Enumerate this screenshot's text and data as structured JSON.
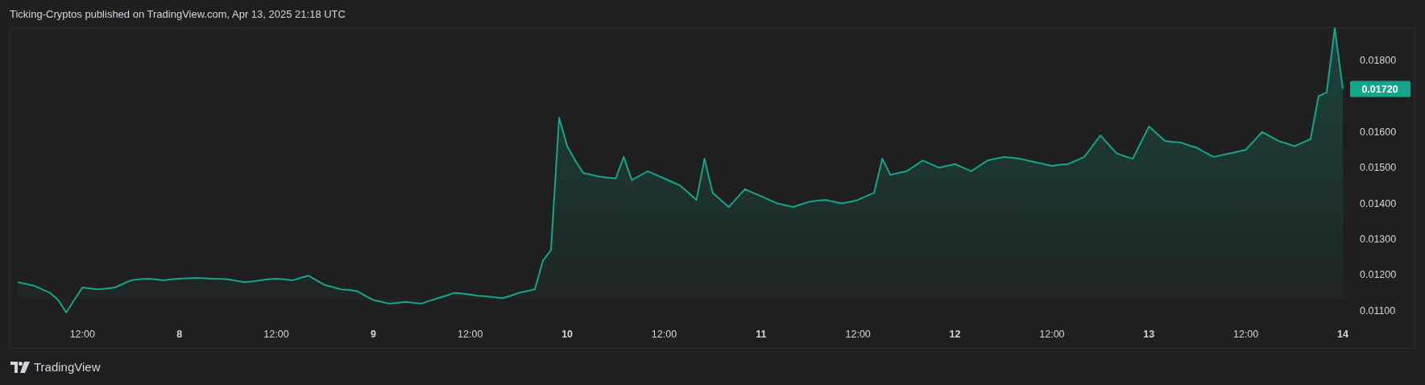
{
  "header": {
    "text": "Ticking-Cryptos published on TradingView.com, Apr 13, 2025 21:18 UTC"
  },
  "chart": {
    "chart_data": {
      "type": "area",
      "categories": [
        null,
        null,
        null,
        null,
        null,
        null,
        null,
        null,
        "12:00",
        null,
        null,
        null,
        null,
        null,
        null,
        null,
        null,
        null,
        null,
        null,
        "8",
        null,
        null,
        null,
        null,
        null,
        null,
        null,
        null,
        null,
        null,
        null,
        "12:00",
        null,
        null,
        null,
        null,
        null,
        null,
        null,
        null,
        null,
        null,
        null,
        "9",
        null,
        null,
        null,
        null,
        null,
        null,
        null,
        null,
        null,
        null,
        null,
        "12:00",
        null,
        null,
        null,
        null,
        null,
        null,
        null,
        null,
        null,
        null,
        null,
        "10",
        null,
        null,
        null,
        null,
        null,
        null,
        null,
        null,
        null,
        null,
        null,
        "12:00",
        null,
        null,
        null,
        null,
        null,
        null,
        null,
        null,
        null,
        null,
        null,
        "11",
        null,
        null,
        null,
        null,
        null,
        null,
        null,
        null,
        null,
        null,
        null,
        "12:00",
        null,
        null,
        null,
        null,
        null,
        null,
        null,
        null,
        null,
        null,
        null,
        "12",
        null,
        null,
        null,
        null,
        null,
        null,
        null,
        null,
        null,
        null,
        null,
        "12:00",
        null,
        null,
        null,
        null,
        null,
        null,
        null,
        null,
        null,
        null,
        null,
        "13",
        null,
        null,
        null,
        null,
        null,
        null,
        null,
        null,
        null,
        null,
        null,
        "12:00",
        null,
        null,
        null,
        null,
        null,
        null,
        null,
        null,
        null,
        null,
        null,
        "14"
      ],
      "series": [
        {
          "color": "#14a58a",
          "values": [
            0.0118,
            0.01175,
            0.0117,
            0.0116,
            0.0115,
            0.0113,
            0.01095,
            0.0113,
            0.01165,
            0.01162,
            0.0116,
            0.01162,
            0.01165,
            0.01175,
            0.01185,
            0.01188,
            0.0119,
            0.01188,
            0.01185,
            0.01188,
            0.0119,
            0.01191,
            0.01192,
            0.01191,
            0.0119,
            0.01189,
            0.01188,
            0.01184,
            0.0118,
            0.01182,
            0.01185,
            0.01188,
            0.0119,
            0.01188,
            0.01185,
            0.01192,
            0.01198,
            0.01185,
            0.01172,
            0.01166,
            0.0116,
            0.01158,
            0.01155,
            0.01142,
            0.0113,
            0.01125,
            0.0112,
            0.01122,
            0.01125,
            0.01122,
            0.0112,
            0.01128,
            0.01135,
            0.01142,
            0.0115,
            0.01148,
            0.01145,
            0.01142,
            0.0114,
            0.01138,
            0.01135,
            0.01142,
            0.0115,
            0.01155,
            0.0116,
            0.0124,
            0.0127,
            0.0164,
            0.0156,
            0.0152,
            0.01485,
            0.0148,
            0.01475,
            0.01472,
            0.0147,
            0.0153,
            0.01465,
            0.01478,
            0.0149,
            0.0148,
            0.0147,
            0.0146,
            0.0145,
            0.0143,
            0.0141,
            0.01525,
            0.0143,
            0.0141,
            0.0139,
            0.01415,
            0.0144,
            0.0143,
            0.0142,
            0.0141,
            0.014,
            0.01395,
            0.0139,
            0.01398,
            0.01405,
            0.01408,
            0.0141,
            0.01405,
            0.014,
            0.01405,
            0.0141,
            0.0142,
            0.0143,
            0.01525,
            0.0148,
            0.01485,
            0.0149,
            0.01505,
            0.0152,
            0.0151,
            0.015,
            0.01505,
            0.0151,
            0.015,
            0.0149,
            0.01505,
            0.0152,
            0.01525,
            0.0153,
            0.01528,
            0.01525,
            0.0152,
            0.01515,
            0.0151,
            0.01505,
            0.01508,
            0.0151,
            0.0152,
            0.0153,
            0.0156,
            0.0159,
            0.01565,
            0.0154,
            0.01532,
            0.01525,
            0.0157,
            0.01615,
            0.01595,
            0.01575,
            0.01572,
            0.0157,
            0.01562,
            0.01555,
            0.01542,
            0.0153,
            0.01535,
            0.0154,
            0.01545,
            0.0155,
            0.01575,
            0.016,
            0.01588,
            0.01575,
            0.01568,
            0.0156,
            0.0157,
            0.0158,
            0.017,
            0.0171,
            0.0189,
            0.0172
          ]
        }
      ],
      "ylim": [
        0.00996,
        0.0189
      ],
      "yticks": [
        {
          "value": 0.011,
          "label": "0.01100"
        },
        {
          "value": 0.012,
          "label": "0.01200"
        },
        {
          "value": 0.013,
          "label": "0.01300"
        },
        {
          "value": 0.014,
          "label": "0.01400"
        },
        {
          "value": 0.015,
          "label": "0.01500"
        },
        {
          "value": 0.016,
          "label": "0.01600"
        },
        {
          "value": 0.018,
          "label": "0.01800"
        }
      ],
      "annotations": [
        "0.01720"
      ]
    }
  },
  "footer": {
    "brand": "TradingView"
  }
}
